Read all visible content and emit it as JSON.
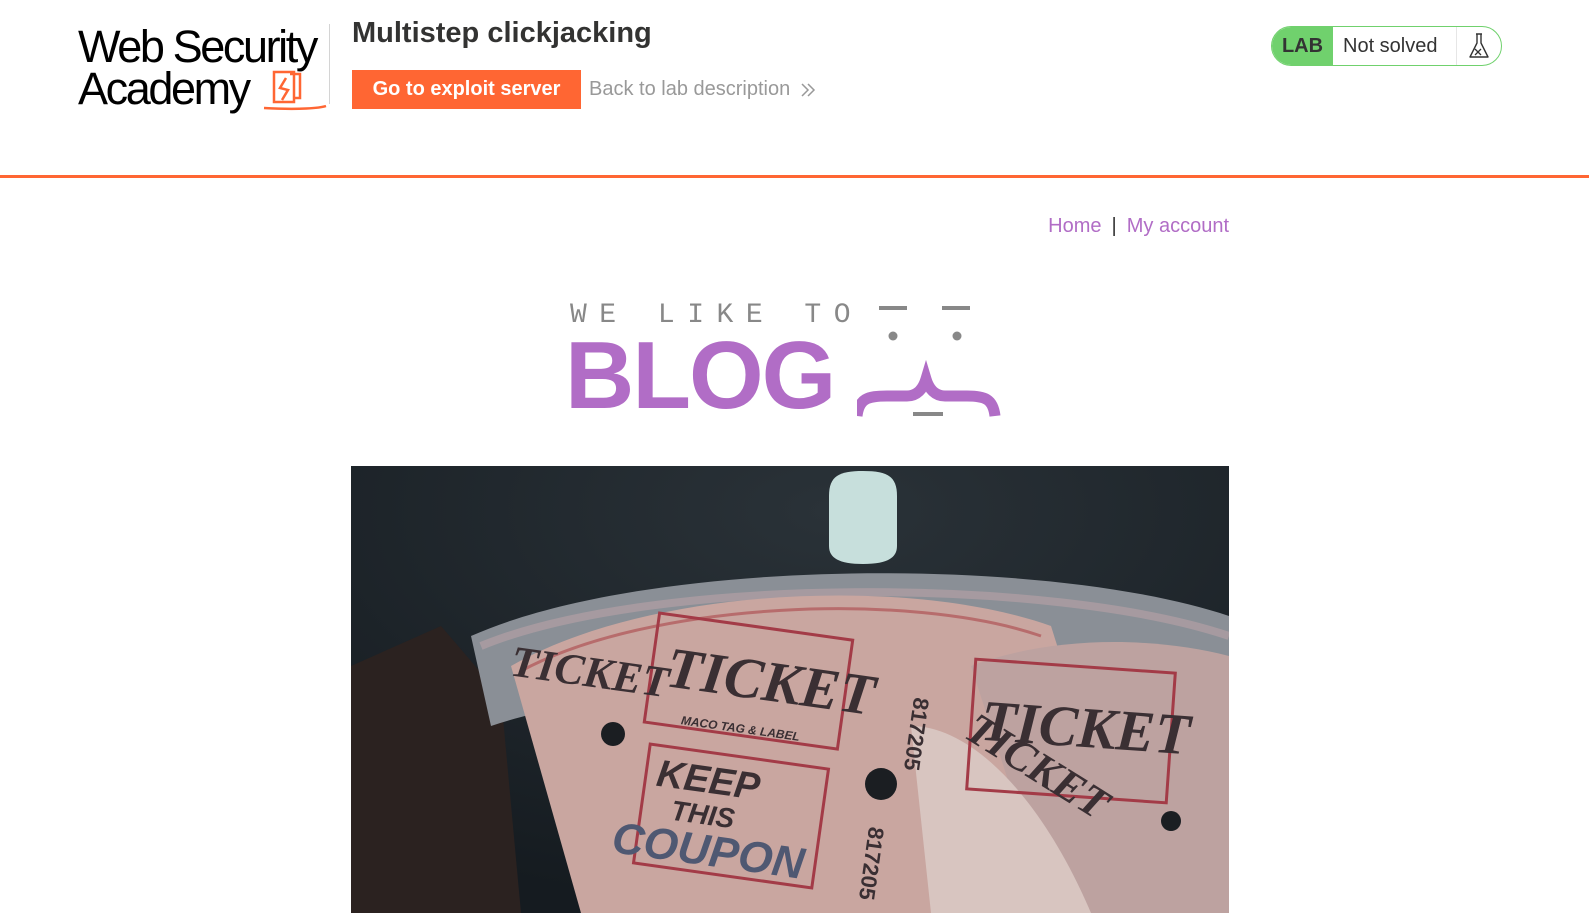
{
  "academy": {
    "logo_line1": "Web Security",
    "logo_line2": "Academy",
    "lab_title": "Multistep clickjacking",
    "exploit_button": "Go to exploit server",
    "back_link": "Back to lab description"
  },
  "lab_status": {
    "label": "LAB",
    "status": "Not solved",
    "icon": "flask-icon"
  },
  "nav": {
    "home": "Home",
    "separator": "|",
    "my_account": "My account"
  },
  "banner": {
    "tagline": "WE LIKE TO",
    "word": "BLOG"
  },
  "post_image": {
    "ticket_word": "TICKET",
    "ticket_number": "817205",
    "ticket_maker": "MACO TAG & LABEL",
    "coupon_line1": "KEEP",
    "coupon_line2": "THIS",
    "coupon_line3": "COUPON"
  },
  "colors": {
    "accent_orange": "#ff6633",
    "lab_green": "#70d16d",
    "blog_purple": "#b16dc6"
  }
}
